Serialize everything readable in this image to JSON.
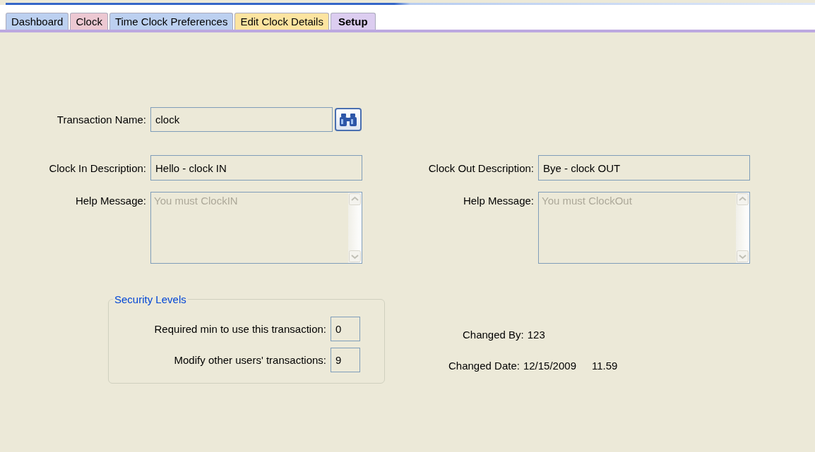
{
  "tabs": [
    {
      "label": "Dashboard",
      "selected": false,
      "color": "#bcd0f0"
    },
    {
      "label": "Clock",
      "selected": false,
      "color": "#ecc8d2"
    },
    {
      "label": "Time Clock Preferences",
      "selected": false,
      "color": "#bcd0f0"
    },
    {
      "label": "Edit Clock Details",
      "selected": false,
      "color": "#fde4a0"
    },
    {
      "label": "Setup",
      "selected": true,
      "color": "#dccdf0"
    }
  ],
  "transaction_name": {
    "label": "Transaction Name:",
    "value": "clock"
  },
  "clock_in": {
    "label": "Clock In Description:",
    "value": "Hello - clock IN",
    "help_label": "Help Message:",
    "help_value": "You must ClockIN",
    "help_disabled": true
  },
  "clock_out": {
    "label": "Clock Out Description:",
    "value": "Bye - clock OUT",
    "help_label": "Help Message:",
    "help_value": "You must ClockOut",
    "help_disabled": true
  },
  "security_levels": {
    "title": "Security Levels",
    "rows": [
      {
        "label": "Required min to use this transaction:",
        "value": "0"
      },
      {
        "label": "Modify other users' transactions:",
        "value": "9"
      }
    ]
  },
  "changed_by": {
    "label": "Changed By:",
    "value": "123"
  },
  "changed_date": {
    "label": "Changed Date:",
    "date": "12/15/2009",
    "time": "11.59"
  }
}
